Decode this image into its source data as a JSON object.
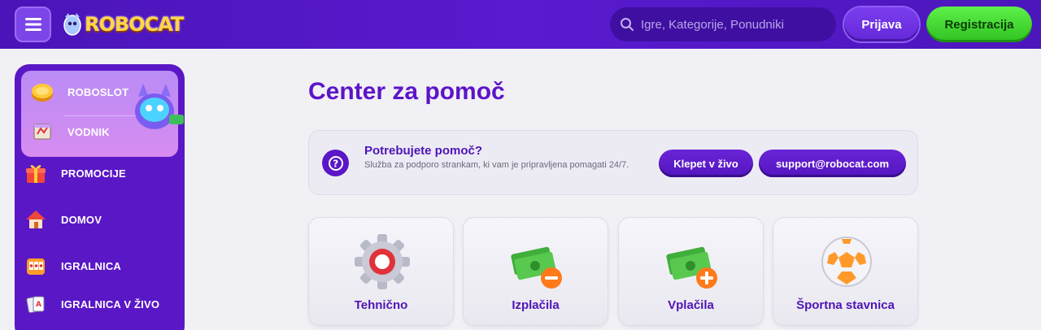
{
  "header": {
    "logo_text": "ROBOCAT",
    "search_placeholder": "Igre, Kategorije, Ponudniki",
    "login_label": "Prijava",
    "register_label": "Registracija"
  },
  "sidebar": {
    "items": [
      {
        "label": "ROBOSLOT",
        "icon": "coin-icon"
      },
      {
        "label": "VODNIK",
        "icon": "map-icon"
      },
      {
        "label": "PROMOCIJE",
        "icon": "gift-icon"
      },
      {
        "label": "DOMOV",
        "icon": "home-icon"
      },
      {
        "label": "IGRALNICA",
        "icon": "slot-icon"
      },
      {
        "label": "IGRALNICA V ŽIVO",
        "icon": "cards-icon"
      }
    ]
  },
  "main": {
    "title": "Center za pomoč",
    "help": {
      "title": "Potrebujete pomoč?",
      "subtitle": "Služba za podporo strankam, ki vam je pripravljena pomagati 24/7.",
      "chat_label": "Klepet v živo",
      "email_label": "support@robocat.com"
    },
    "categories": [
      {
        "label": "Tehnično",
        "icon": "gear-icon"
      },
      {
        "label": "Izplačila",
        "icon": "money-minus-icon"
      },
      {
        "label": "Vplačila",
        "icon": "money-plus-icon"
      },
      {
        "label": "Športna stavnica",
        "icon": "soccer-ball-icon"
      }
    ]
  },
  "colors": {
    "header": "#4a14b8",
    "accent": "#5c14c8",
    "register": "#3fd22f",
    "background": "#f1f0f5"
  }
}
